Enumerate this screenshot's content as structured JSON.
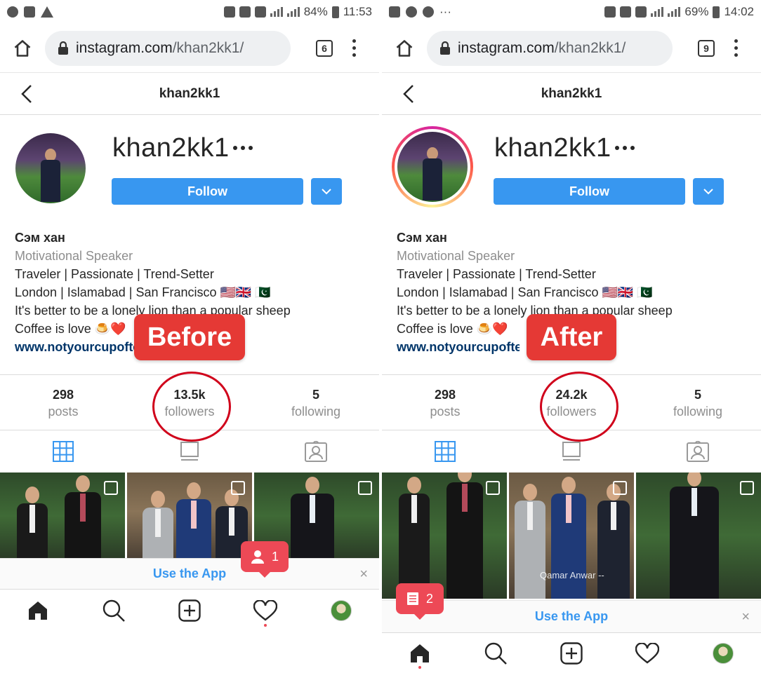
{
  "left": {
    "status": {
      "battery": "84%",
      "time": "11:53"
    },
    "browser": {
      "url_host": "instagram.com",
      "url_path": "/khan2kk1/",
      "tab_count": "6"
    },
    "header": {
      "title": "khan2kk1"
    },
    "profile": {
      "username": "khan2kk1",
      "follow_label": "Follow",
      "full_name": "Сэм хан",
      "category": "Motivational Speaker",
      "bio_lines": [
        "Traveler | Passionate | Trend-Setter",
        "London | Islamabad | San Francisco 🇺🇸🇬🇧 🇵🇰",
        "It's better to be a lonely lion than a popular sheep",
        "Coffee is love 🍮❤️"
      ],
      "website": "www.notyourcupoftea.com"
    },
    "tag": "Before",
    "stats": [
      {
        "value": "298",
        "label": "posts"
      },
      {
        "value": "13.5k",
        "label": "followers"
      },
      {
        "value": "5",
        "label": "following"
      }
    ],
    "use_app": "Use the App",
    "close_symbol": "×",
    "notification": {
      "count": "1",
      "icon": "user-icon"
    }
  },
  "right": {
    "status": {
      "battery": "69%",
      "time": "14:02"
    },
    "browser": {
      "url_host": "instagram.com",
      "url_path": "/khan2kk1/",
      "tab_count": "9"
    },
    "header": {
      "title": "khan2kk1"
    },
    "profile": {
      "username": "khan2kk1",
      "follow_label": "Follow",
      "full_name": "Сэм хан",
      "category": "Motivational Speaker",
      "bio_lines": [
        "Traveler | Passionate | Trend-Setter",
        "London | Islamabad | San Francisco 🇺🇸🇬🇧 🇵🇰",
        "It's better to be a lonely lion than a popular sheep",
        "Coffee is love 🍮❤️"
      ],
      "website": "www.notyourcupoftea.com"
    },
    "tag": "After",
    "stats": [
      {
        "value": "298",
        "label": "posts"
      },
      {
        "value": "24.2k",
        "label": "followers"
      },
      {
        "value": "5",
        "label": "following"
      }
    ],
    "post_caption": "Qamar Anwar --",
    "use_app": "Use the App",
    "close_symbol": "×",
    "notification": {
      "count": "2",
      "icon": "posts-icon"
    }
  },
  "colors": {
    "follow_blue": "#3897f0",
    "tag_red": "#e53935",
    "circle_red": "#d0021b",
    "notif_red": "#ed4956",
    "muted_text": "#8e8e8e"
  }
}
